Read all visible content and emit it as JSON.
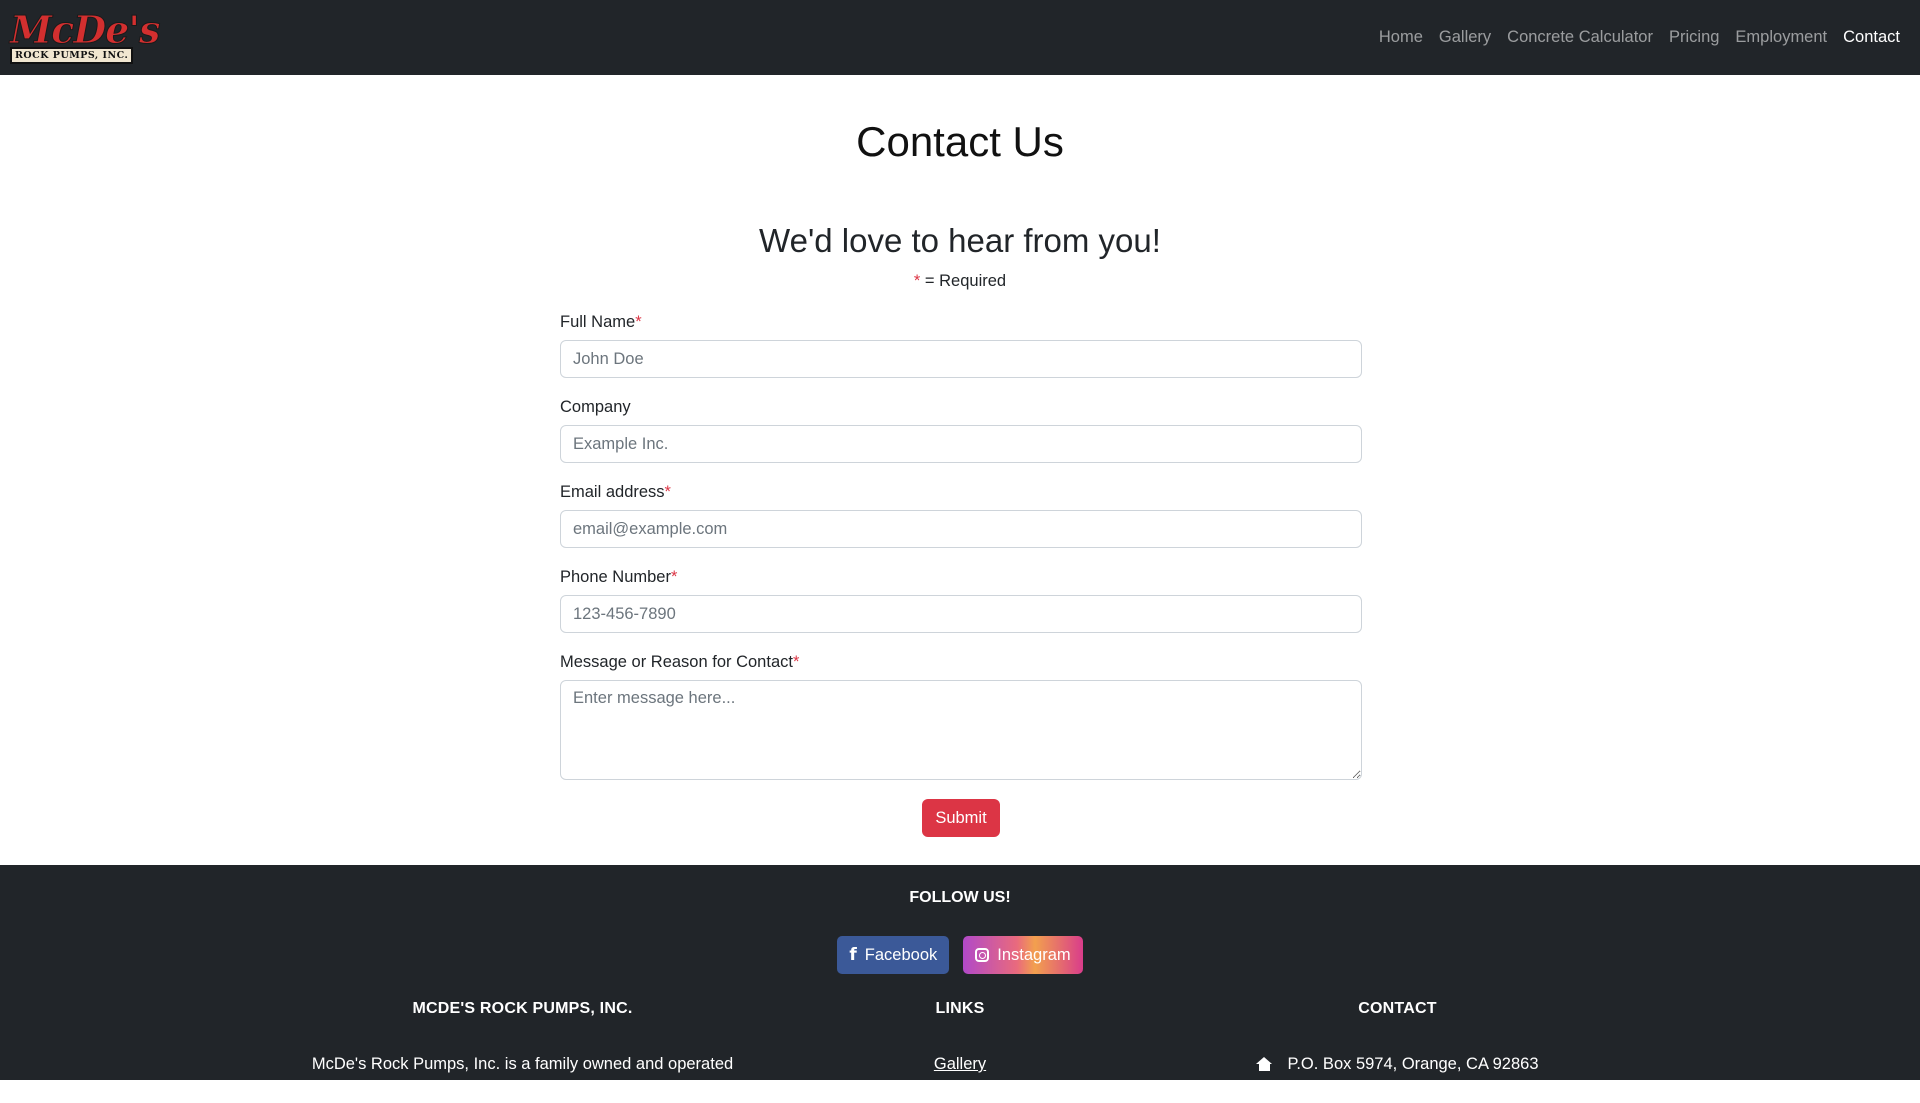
{
  "brand": {
    "logo_script": "McDe's",
    "logo_plate": "ROCK PUMPS, INC."
  },
  "nav": {
    "items": [
      {
        "label": "Home"
      },
      {
        "label": "Gallery"
      },
      {
        "label": "Concrete Calculator"
      },
      {
        "label": "Pricing"
      },
      {
        "label": "Employment"
      },
      {
        "label": "Contact",
        "active": true
      }
    ]
  },
  "main": {
    "title": "Contact Us",
    "subtitle": "We'd love to hear from you!",
    "required_star": "*",
    "required_text": " = Required"
  },
  "form": {
    "full_name": {
      "label": "Full Name",
      "required": "*",
      "placeholder": "John Doe",
      "value": ""
    },
    "company": {
      "label": "Company",
      "placeholder": "Example Inc.",
      "value": ""
    },
    "email": {
      "label": "Email address",
      "required": "*",
      "placeholder": "email@example.com",
      "value": ""
    },
    "phone": {
      "label": "Phone Number",
      "required": "*",
      "placeholder": "123-456-7890",
      "value": ""
    },
    "message": {
      "label": "Message or Reason for Contact",
      "required": "*",
      "placeholder": "Enter message here...",
      "value": ""
    },
    "submit_label": "Submit"
  },
  "footer": {
    "follow_title": "FOLLOW US!",
    "facebook_label": "Facebook",
    "instagram_label": "Instagram",
    "col1_title": "MCDE'S ROCK PUMPS, INC.",
    "col1_text": "McDe's Rock Pumps, Inc. is a family owned and operated concrete pump company in Southern California.",
    "col2_title": "LINKS",
    "col2_link": "Gallery",
    "col3_title": "CONTACT",
    "col3_address": "P.O. Box 5974, Orange, CA 92863"
  },
  "colors": {
    "navbar_bg": "#212529",
    "accent_red": "#dc3545",
    "facebook_blue": "#3b5998"
  },
  "icons": [
    "facebook-icon",
    "instagram-icon",
    "home-icon"
  ]
}
